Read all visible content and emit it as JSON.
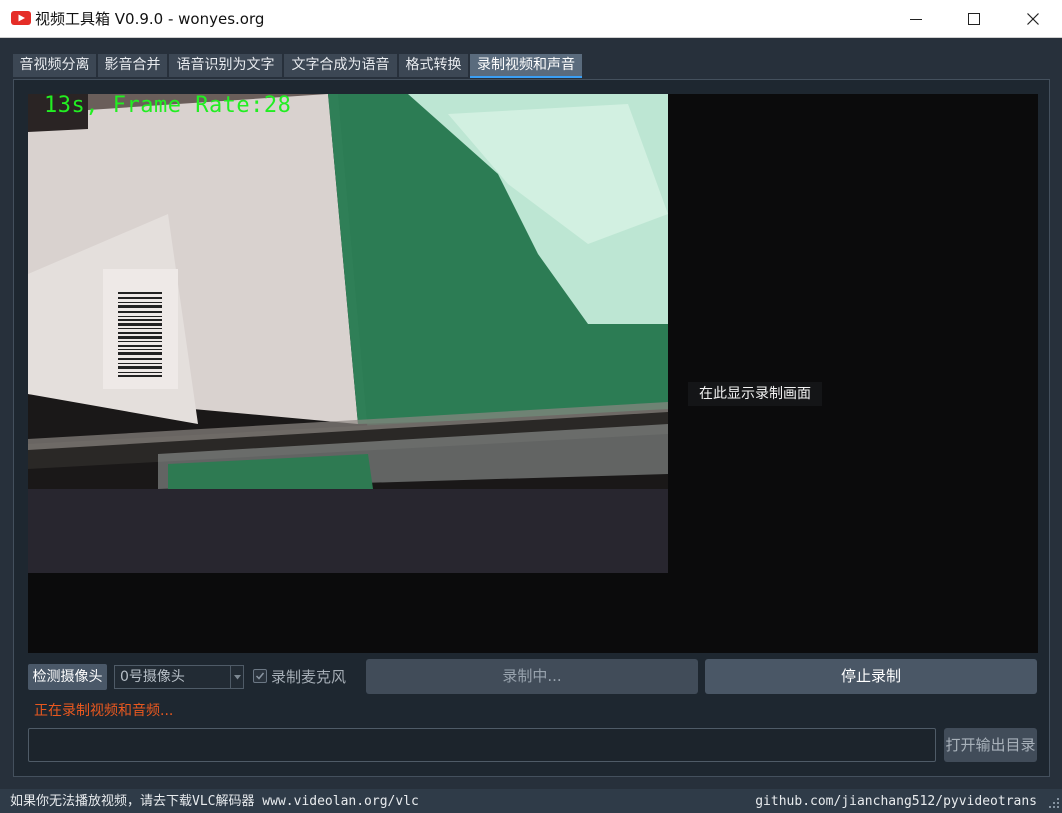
{
  "window": {
    "title": "视频工具箱 V0.9.0 - wonyes.org",
    "icon": "video-play-icon",
    "controls": [
      "minimize-icon",
      "maximize-icon",
      "close-icon"
    ]
  },
  "tabs": [
    {
      "label": "音视频分离",
      "active": false
    },
    {
      "label": "影音合并",
      "active": false
    },
    {
      "label": "语音识别为文字",
      "active": false
    },
    {
      "label": "文字合成为语音",
      "active": false
    },
    {
      "label": "格式转换",
      "active": false
    },
    {
      "label": "录制视频和声音",
      "active": true
    }
  ],
  "preview": {
    "overlay_text": "13s, Frame Rate:28",
    "placeholder": "在此显示录制画面"
  },
  "controls": {
    "detect_camera_label": "检测摄像头",
    "camera_select_value": "0号摄像头",
    "record_mic_label": "录制麦克风",
    "record_mic_checked": true,
    "recording_label": "录制中...",
    "stop_label": "停止录制",
    "status_message": "正在录制视频和音频...",
    "output_path": "",
    "open_output_label": "打开输出目录"
  },
  "statusbar": {
    "left_text": "如果你无法播放视频，请去下载VLC解码器 www.videolan.org/vlc",
    "right_text": "github.com/jianchang512/pyvideotrans"
  },
  "colors": {
    "background": "#27303b",
    "panel": "#1e2730",
    "active_tab_underline": "#3a9ff5",
    "status_message": "#e9581f",
    "overlay_text": "#22ee22"
  }
}
